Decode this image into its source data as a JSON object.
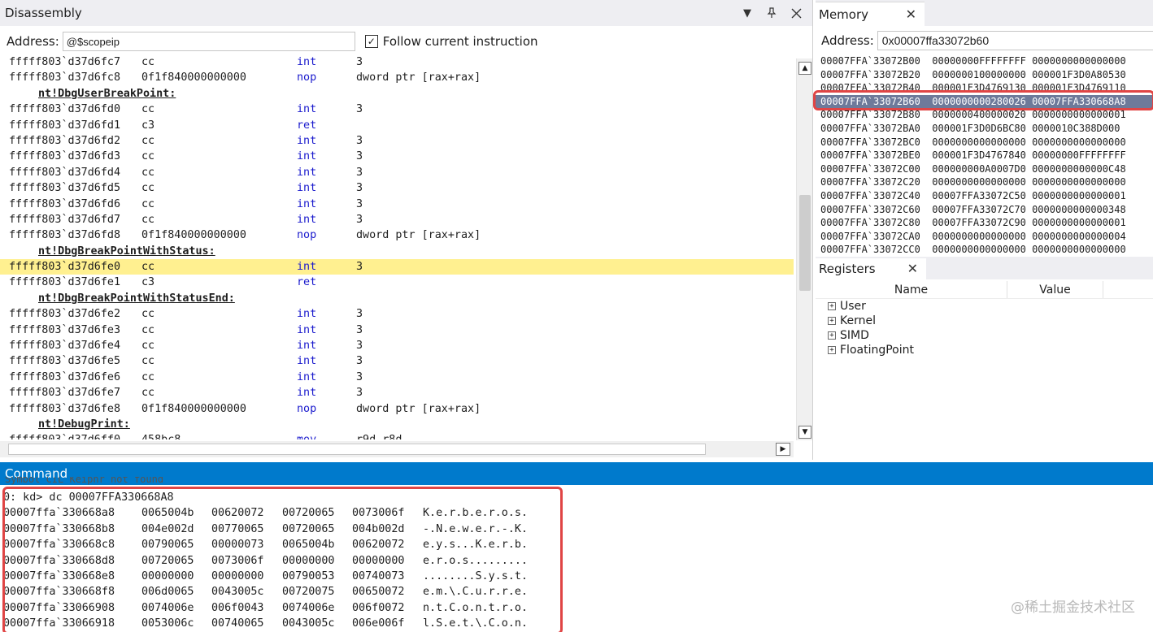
{
  "disassembly": {
    "title": "Disassembly",
    "address_label": "Address:",
    "address_value": "@$scopeip",
    "follow_label": "Follow current instruction",
    "follow_checked": "✓",
    "lines": [
      {
        "kind": "ins",
        "addr": "fffff803`d37d6fc7",
        "bytes": "cc",
        "op": "int",
        "arg": "3"
      },
      {
        "kind": "ins",
        "addr": "fffff803`d37d6fc8",
        "bytes": "0f1f840000000000",
        "op": "nop",
        "arg": "dword ptr [rax+rax]"
      },
      {
        "kind": "sym",
        "text": "nt!DbgUserBreakPoint:"
      },
      {
        "kind": "ins",
        "addr": "fffff803`d37d6fd0",
        "bytes": "cc",
        "op": "int",
        "arg": "3"
      },
      {
        "kind": "ins",
        "addr": "fffff803`d37d6fd1",
        "bytes": "c3",
        "op": "ret",
        "arg": ""
      },
      {
        "kind": "ins",
        "addr": "fffff803`d37d6fd2",
        "bytes": "cc",
        "op": "int",
        "arg": "3"
      },
      {
        "kind": "ins",
        "addr": "fffff803`d37d6fd3",
        "bytes": "cc",
        "op": "int",
        "arg": "3"
      },
      {
        "kind": "ins",
        "addr": "fffff803`d37d6fd4",
        "bytes": "cc",
        "op": "int",
        "arg": "3"
      },
      {
        "kind": "ins",
        "addr": "fffff803`d37d6fd5",
        "bytes": "cc",
        "op": "int",
        "arg": "3"
      },
      {
        "kind": "ins",
        "addr": "fffff803`d37d6fd6",
        "bytes": "cc",
        "op": "int",
        "arg": "3"
      },
      {
        "kind": "ins",
        "addr": "fffff803`d37d6fd7",
        "bytes": "cc",
        "op": "int",
        "arg": "3"
      },
      {
        "kind": "ins",
        "addr": "fffff803`d37d6fd8",
        "bytes": "0f1f840000000000",
        "op": "nop",
        "arg": "dword ptr [rax+rax]"
      },
      {
        "kind": "sym",
        "text": "nt!DbgBreakPointWithStatus:"
      },
      {
        "kind": "ins",
        "addr": "fffff803`d37d6fe0",
        "bytes": "cc",
        "op": "int",
        "arg": "3",
        "current": true
      },
      {
        "kind": "ins",
        "addr": "fffff803`d37d6fe1",
        "bytes": "c3",
        "op": "ret",
        "arg": ""
      },
      {
        "kind": "sym",
        "text": "nt!DbgBreakPointWithStatusEnd:"
      },
      {
        "kind": "ins",
        "addr": "fffff803`d37d6fe2",
        "bytes": "cc",
        "op": "int",
        "arg": "3"
      },
      {
        "kind": "ins",
        "addr": "fffff803`d37d6fe3",
        "bytes": "cc",
        "op": "int",
        "arg": "3"
      },
      {
        "kind": "ins",
        "addr": "fffff803`d37d6fe4",
        "bytes": "cc",
        "op": "int",
        "arg": "3"
      },
      {
        "kind": "ins",
        "addr": "fffff803`d37d6fe5",
        "bytes": "cc",
        "op": "int",
        "arg": "3"
      },
      {
        "kind": "ins",
        "addr": "fffff803`d37d6fe6",
        "bytes": "cc",
        "op": "int",
        "arg": "3"
      },
      {
        "kind": "ins",
        "addr": "fffff803`d37d6fe7",
        "bytes": "cc",
        "op": "int",
        "arg": "3"
      },
      {
        "kind": "ins",
        "addr": "fffff803`d37d6fe8",
        "bytes": "0f1f840000000000",
        "op": "nop",
        "arg": "dword ptr [rax+rax]"
      },
      {
        "kind": "sym",
        "text": "nt!DebugPrint:"
      },
      {
        "kind": "ins",
        "addr": "fffff803`d37d6ff0",
        "bytes": "458bc8",
        "op": "mov",
        "arg": "r9d,r8d"
      }
    ]
  },
  "memory": {
    "tab_label": "Memory",
    "address_label": "Address:",
    "address_value": "0x00007ffa33072b60",
    "rows": [
      {
        "text": "00007FFA`33072B00  00000000FFFFFFFF 0000000000000000"
      },
      {
        "text": "00007FFA`33072B20  0000000100000000 000001F3D0A80530"
      },
      {
        "text": "00007FFA`33072B40  000001F3D4769130 000001F3D4769110"
      },
      {
        "text": "00007FFA`33072B60  0000000000280026 00007FFA330668A8",
        "selected": true
      },
      {
        "text": "00007FFA`33072B80  0000000400000020 0000000000000001"
      },
      {
        "text": "00007FFA`33072BA0  000001F3D0D6BC80 0000010C388D000"
      },
      {
        "text": "00007FFA`33072BC0  0000000000000000 0000000000000000"
      },
      {
        "text": "00007FFA`33072BE0  000001F3D4767840 00000000FFFFFFFF"
      },
      {
        "text": "00007FFA`33072C00  000000000A0007D0 0000000000000C48"
      },
      {
        "text": "00007FFA`33072C20  0000000000000000 0000000000000000"
      },
      {
        "text": "00007FFA`33072C40  00007FFA33072C50 0000000000000001"
      },
      {
        "text": "00007FFA`33072C60  00007FFA33072C70 0000000000000348"
      },
      {
        "text": "00007FFA`33072C80  00007FFA33072C90 0000000000000001"
      },
      {
        "text": "00007FFA`33072CA0  0000000000000000 0000000000000004"
      },
      {
        "text": "00007FFA`33072CC0  0000000000000000 0000000000000000"
      }
    ]
  },
  "registers": {
    "tab_label": "Registers",
    "col_name": "Name",
    "col_value": "Value",
    "groups": [
      "User",
      "Kernel",
      "SIMD",
      "FloatingPoint"
    ]
  },
  "command": {
    "title": "Command",
    "cutoff_text": "Symbol  CIL Keipnr not found",
    "prompt_line": "0: kd> dc 00007FFA330668A8",
    "rows": [
      {
        "addr": "00007ffa`330668a8",
        "d": [
          "0065004b",
          "00620072",
          "00720065",
          "0073006f"
        ],
        "ascii": "K.e.r.b.e.r.o.s."
      },
      {
        "addr": "00007ffa`330668b8",
        "d": [
          "004e002d",
          "00770065",
          "00720065",
          "004b002d"
        ],
        "ascii": "-.N.e.w.e.r.-.K."
      },
      {
        "addr": "00007ffa`330668c8",
        "d": [
          "00790065",
          "00000073",
          "0065004b",
          "00620072"
        ],
        "ascii": "e.y.s...K.e.r.b."
      },
      {
        "addr": "00007ffa`330668d8",
        "d": [
          "00720065",
          "0073006f",
          "00000000",
          "00000000"
        ],
        "ascii": "e.r.o.s........."
      },
      {
        "addr": "00007ffa`330668e8",
        "d": [
          "00000000",
          "00000000",
          "00790053",
          "00740073"
        ],
        "ascii": "........S.y.s.t."
      },
      {
        "addr": "00007ffa`330668f8",
        "d": [
          "006d0065",
          "0043005c",
          "00720075",
          "00650072"
        ],
        "ascii": "e.m.\\.C.u.r.r.e."
      },
      {
        "addr": "00007ffa`33066908",
        "d": [
          "0074006e",
          "006f0043",
          "0074006e",
          "006f0072"
        ],
        "ascii": "n.t.C.o.n.t.r.o."
      },
      {
        "addr": "00007ffa`33066918",
        "d": [
          "0053006c",
          "00740065",
          "0043005c",
          "006e006f"
        ],
        "ascii": "l.S.e.t.\\.C.o.n."
      }
    ]
  },
  "watermark": "@稀土掘金技术社区",
  "colors": {
    "highlight": "#fff090",
    "accent": "#007acc",
    "annotation_red": "#e04545",
    "selected_row": "#6e7a9a",
    "opcode_blue": "#1a1acd"
  }
}
